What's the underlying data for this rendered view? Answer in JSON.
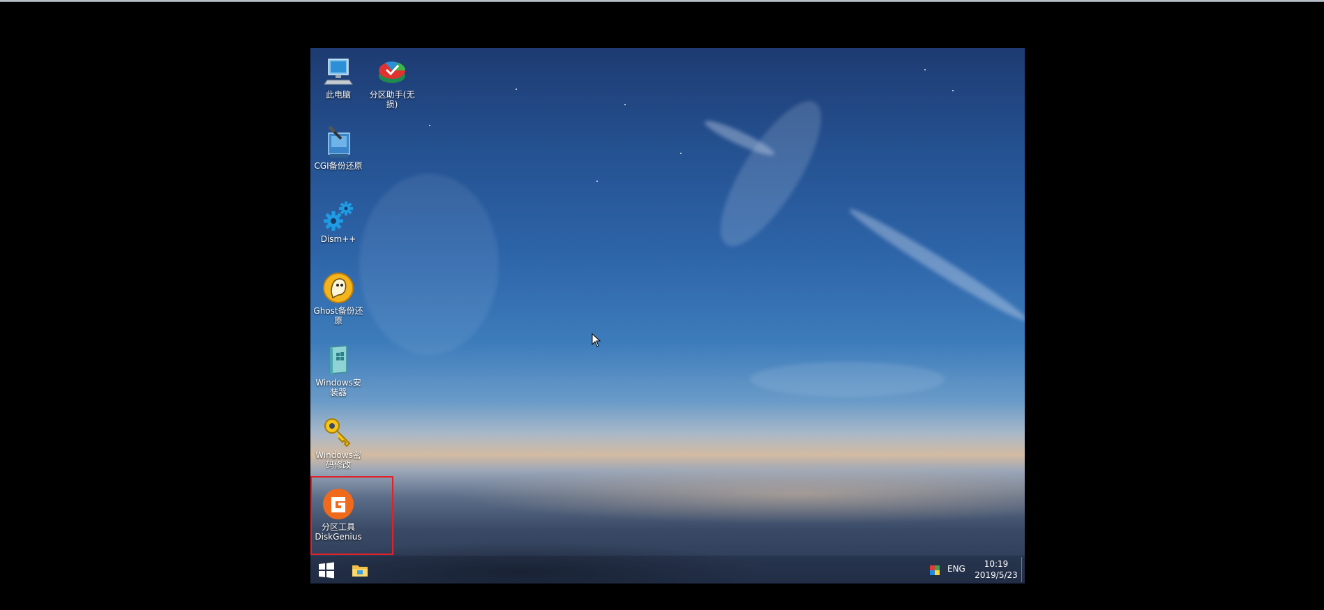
{
  "desktop": {
    "icons": [
      {
        "label": "此电脑",
        "icon": "this-pc-icon"
      },
      {
        "label_line1": "分区助手(无",
        "label_line2": "损)",
        "icon": "partition-assistant-icon"
      },
      {
        "label": "CGI备份还原",
        "icon": "cgi-backup-icon"
      },
      {
        "label": "Dism++",
        "icon": "dism-gears-icon"
      },
      {
        "label_line1": "Ghost备份还",
        "label_line2": "原",
        "icon": "ghost-icon"
      },
      {
        "label_line1": "Windows安",
        "label_line2": "装器",
        "icon": "windows-installer-icon"
      },
      {
        "label_line1": "Windows密",
        "label_line2": "码修改",
        "icon": "key-icon"
      },
      {
        "label_line1": "分区工具",
        "label_line2": "DiskGenius",
        "icon": "diskgenius-icon"
      }
    ],
    "highlight_color": "#e0232b"
  },
  "taskbar": {
    "language": "ENG",
    "time": "10:19",
    "date": "2019/5/23",
    "start_icon": "windows-start-icon",
    "explorer_icon": "file-explorer-icon"
  }
}
